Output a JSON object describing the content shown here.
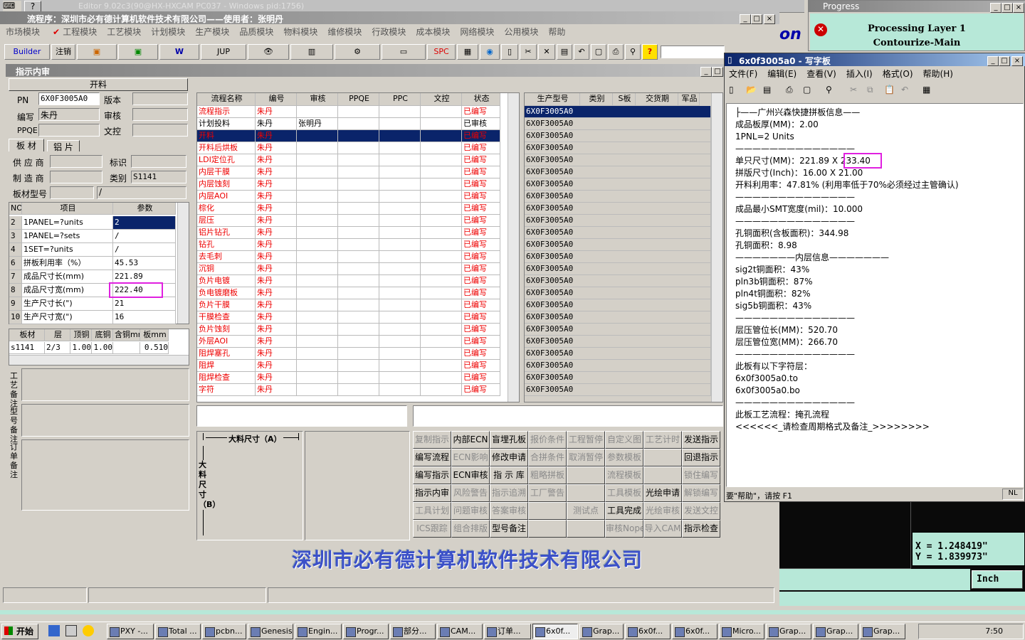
{
  "top_strip": {
    "title": "Editor 9.02c3(90@HX-HXCAM PC037 - Windows pid:1756)",
    "app_title": "流程序：深圳市必有德计算机软件技术有限公司——使用者：张明丹"
  },
  "menu": [
    "市场模块",
    "工程模块",
    "工艺模块",
    "计划模块",
    "生产模块",
    "品质模块",
    "物料模块",
    "维修模块",
    "行政模块",
    "成本模块",
    "网络模块",
    "公用模块",
    "帮助"
  ],
  "toolbar": {
    "builder": "Builder",
    "logout": "注销",
    "word": "W",
    "jup": "JUP",
    "spc": "SPC",
    "help": "?"
  },
  "inner": {
    "title": "指示内审"
  },
  "left": {
    "header": "开料",
    "pn_label": "PN",
    "pn_value": "6X0F3005A0",
    "version_label": "版本",
    "code_label": "编写",
    "code_value": "朱丹",
    "review_label": "审核",
    "ppqe_label": "PPQE",
    "doc_label": "文控",
    "tab1": "板 材",
    "tab2": "铝 片",
    "supplier_label": "供 应 商",
    "mark_label": "标识",
    "maker_label": "制 造 商",
    "type_label": "类别",
    "type_value": "S1141",
    "model_label": "板材型号",
    "model_value": "/",
    "grid_headers": [
      "NO",
      "项目",
      "参数"
    ],
    "grid_rows": [
      [
        "2",
        "1PANEL=?units",
        "2"
      ],
      [
        "3",
        "1PANEL=?sets",
        "/"
      ],
      [
        "4",
        "1SET=?units",
        "/"
      ],
      [
        "6",
        "拼板利用率（%）",
        "45.53"
      ],
      [
        "7",
        "成品尺寸长(mm)",
        "221.89"
      ],
      [
        "8",
        "成品尺寸宽(mm)",
        "222.40"
      ],
      [
        "9",
        "生产尺寸长(\")",
        "21"
      ],
      [
        "10",
        "生产尺寸宽(\")",
        "16"
      ]
    ],
    "mat_headers": [
      "板材",
      "层",
      "顶铜",
      "底铜",
      "含铜mm",
      "板mm"
    ],
    "mat_row": [
      "s1141",
      "2/3",
      "1.00",
      "1.00",
      "",
      "0.510"
    ],
    "notes": [
      "工艺备注",
      "型号备注",
      "订单备注"
    ]
  },
  "flow": {
    "headers": [
      "流程名称",
      "编号",
      "审核",
      "PPQE",
      "PPC",
      "文控",
      "状态"
    ],
    "rows": [
      [
        "流程指示",
        "朱丹",
        "",
        "已编写"
      ],
      [
        "计划投料",
        "朱丹",
        "张明丹",
        "已审核"
      ],
      [
        "开料",
        "朱丹",
        "",
        "已编写"
      ],
      [
        "开料后烘板",
        "朱丹",
        "",
        "已编写"
      ],
      [
        "LDI定位孔",
        "朱丹",
        "",
        "已编写"
      ],
      [
        "内层干膜",
        "朱丹",
        "",
        "已编写"
      ],
      [
        "内层蚀刻",
        "朱丹",
        "",
        "已编写"
      ],
      [
        "内层AOI",
        "朱丹",
        "",
        "已编写"
      ],
      [
        "棕化",
        "朱丹",
        "",
        "已编写"
      ],
      [
        "层压",
        "朱丹",
        "",
        "已编写"
      ],
      [
        "铝片钻孔",
        "朱丹",
        "",
        "已编写"
      ],
      [
        "钻孔",
        "朱丹",
        "",
        "已编写"
      ],
      [
        "去毛刺",
        "朱丹",
        "",
        "已编写"
      ],
      [
        "沉铜",
        "朱丹",
        "",
        "已编写"
      ],
      [
        "负片电镀",
        "朱丹",
        "",
        "已编写"
      ],
      [
        "负电镀磨板",
        "朱丹",
        "",
        "已编写"
      ],
      [
        "负片干膜",
        "朱丹",
        "",
        "已编写"
      ],
      [
        "干膜检查",
        "朱丹",
        "",
        "已编写"
      ],
      [
        "负片蚀刻",
        "朱丹",
        "",
        "已编写"
      ],
      [
        "外层AOI",
        "朱丹",
        "",
        "已编写"
      ],
      [
        "阻焊塞孔",
        "朱丹",
        "",
        "已编写"
      ],
      [
        "阻焊",
        "朱丹",
        "",
        "已编写"
      ],
      [
        "阻焊检查",
        "朱丹",
        "",
        "已编写"
      ],
      [
        "字符",
        "朱丹",
        "",
        "已编写"
      ]
    ]
  },
  "models": {
    "headers": [
      "生产型号",
      "类别",
      "S板",
      "交货期",
      "军品"
    ],
    "value": "6X0F3005A0",
    "count": 24
  },
  "diagram": {
    "a_label": "大料尺寸（A）",
    "b_label": "大料尺寸（B）"
  },
  "buttons": [
    [
      "复制指示",
      "内部ECN",
      "盲埋孔板",
      "报价条件",
      "工程暂停",
      "自定义图",
      "工艺计时",
      "发送指示"
    ],
    [
      "编写流程",
      "ECN影响",
      "修改申请",
      "合拼条件",
      "取消暂停",
      "参数模板",
      "",
      "回退指示"
    ],
    [
      "编写指示",
      "ECN审核",
      "指 示 库",
      "粗略拼板",
      "",
      "流程模板",
      "",
      "锁住编写"
    ],
    [
      "指示内审",
      "风险警告",
      "指示追溯",
      "工厂警告",
      "",
      "工具模板",
      "光绘申请",
      "解锁编写"
    ],
    [
      "工具计划",
      "问题审核",
      "答案审核",
      "",
      "测试点",
      "工具完成",
      "光绘审核",
      "发送文控"
    ],
    [
      "ICS跟踪",
      "组合排版",
      "型号备注",
      "",
      "",
      "审核Nope",
      "导入CAM",
      "指示检查"
    ]
  ],
  "buttons_disabled": [
    [
      "复制指示",
      "报价条件",
      "工程暂停",
      "自定义图",
      "工艺计时"
    ],
    [
      "ECN影响",
      "合拼条件",
      "取消暂停",
      "参数模板"
    ],
    [
      "粗略拼板",
      "流程模板",
      "锁住编写"
    ],
    [
      "风险警告",
      "指示追溯",
      "工厂警告",
      "工具模板",
      "解锁编写"
    ],
    [
      "工具计划",
      "问题审核",
      "答案审核",
      "测试点",
      "光绘审核",
      "发送文控"
    ],
    [
      "ICS跟踪",
      "组合排版",
      "审核Nope",
      "导入CAM"
    ]
  ],
  "banner": "深圳市必有德计算机软件技术有限公司",
  "progress": {
    "title": "Progress",
    "line1": "Processing Layer 1",
    "line2": "Contourize-Main"
  },
  "wordpad": {
    "title": "6x0f3005a0 - 写字板",
    "menu": [
      "文件(F)",
      "编辑(E)",
      "查看(V)",
      "插入(I)",
      "格式(O)",
      "帮助(H)"
    ],
    "lines": [
      "├——广州兴森快捷拼板信息——",
      "成品板厚(MM)：2.00",
      "1PNL=2 Units",
      "——————————————",
      "单只尺寸(MM)：221.89 X 233.40",
      "拼版尺寸(Inch)：16.00 X 21.00",
      "开料利用率：47.81% (利用率低于70%必须经过主管确认)",
      "——————————————",
      "成品最小SMT宽度(mil)：10.000",
      "——————————————",
      "孔铜面积(含板面积)：344.98",
      "孔铜面积：8.98",
      "———————内层信息———————",
      "sig2t铜面积：43%",
      "pln3b铜面积：87%",
      "pln4t铜面积：82%",
      "sig5b铜面积：43%",
      "——————————————",
      "层压管位长(MM)：520.70",
      "层压管位宽(MM)：266.70",
      "——————————————",
      "此板有以下字符层：",
      "6x0f3005a0.to",
      "6x0f3005a0.bo",
      "——————————————",
      "此板工艺流程：掩孔流程",
      "<<<<<<_请检查周期格式及备注_>>>>>>>>"
    ],
    "status": "要\"帮助\"，请按 F1",
    "status_nl": "NL"
  },
  "coords": {
    "x": "X = 1.248419\"",
    "y": "Y = 1.839973\"",
    "unit": "Inch"
  },
  "taskbar": {
    "start": "开始",
    "items": [
      "PXY -...",
      "Total ...",
      "pcbn...",
      "Genesis",
      "Engin...",
      "Progr...",
      "部分...",
      "CAM...",
      "订单...",
      "6x0f...",
      "Grap...",
      "6x0f...",
      "6x0f...",
      "Micro...",
      "Grap...",
      "Grap...",
      "Grap..."
    ],
    "clock": "7:50"
  },
  "colors": {
    "title_blue": "#0a246a",
    "mint": "#b7e8d8",
    "dark_panel": "#0a0a0a",
    "banner": "#3b50c8"
  }
}
